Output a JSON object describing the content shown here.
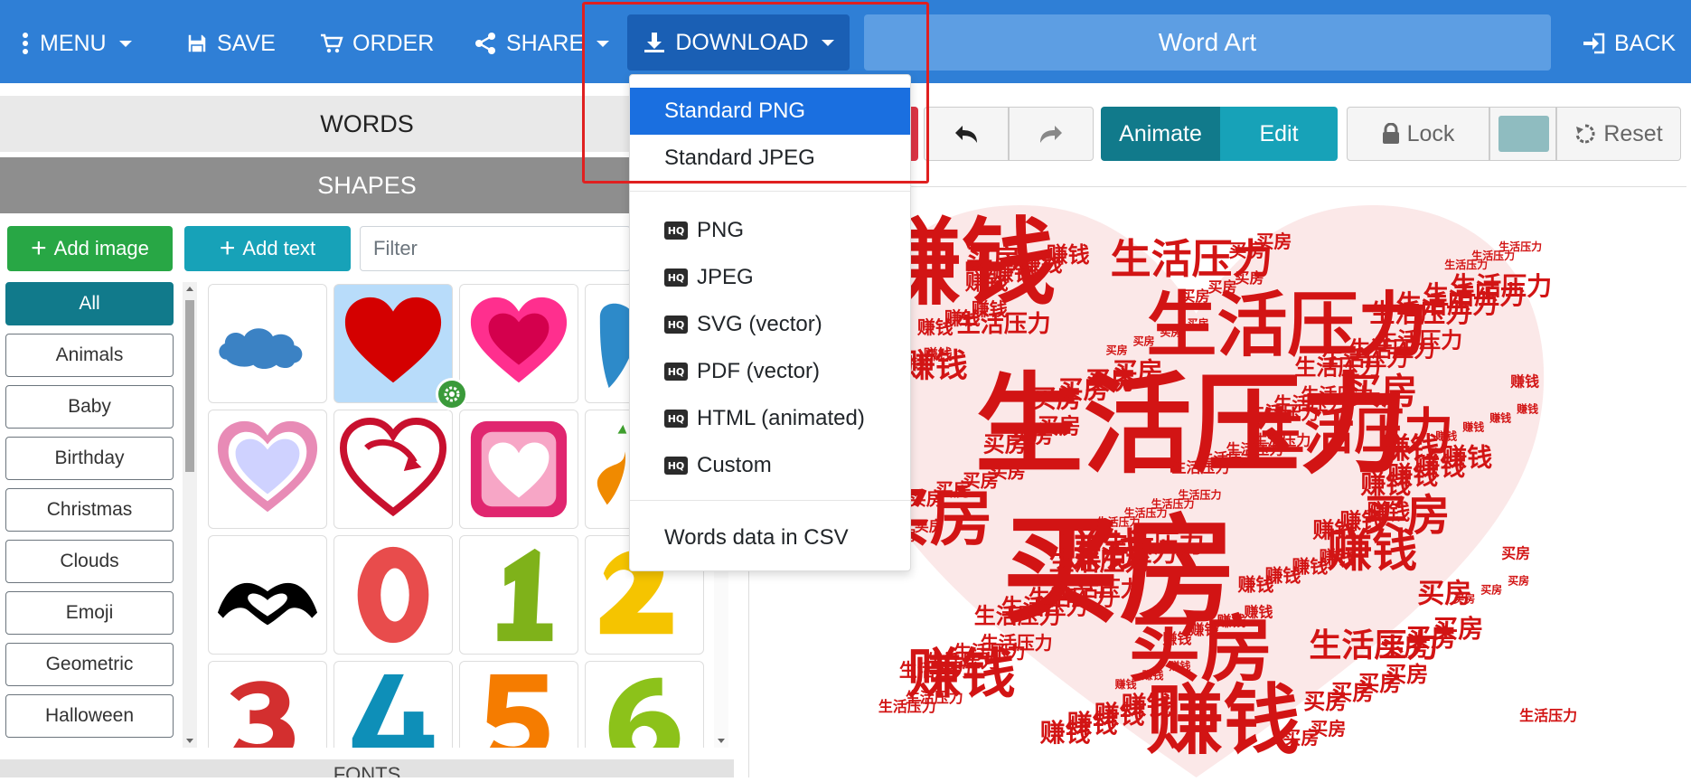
{
  "topbar": {
    "menu_label": "MENU",
    "save_label": "SAVE",
    "order_label": "ORDER",
    "share_label": "SHARE",
    "download_label": "DOWNLOAD",
    "title": "Word Art",
    "back_label": "BACK"
  },
  "left_panel": {
    "words_header": "WORDS",
    "shapes_header": "SHAPES",
    "fonts_header": "FONTS",
    "add_image_label": "Add image",
    "add_text_label": "Add text",
    "filter_placeholder": "Filter",
    "categories": [
      "All",
      "Animals",
      "Baby",
      "Birthday",
      "Christmas",
      "Clouds",
      "Emoji",
      "Geometric",
      "Halloween"
    ],
    "shape_tiles": [
      "cloud-shape",
      "red-heart-shape",
      "pink-heart-shape",
      "blue-drop-shape",
      "outline-heart-shape",
      "arrow-heart-shape",
      "square-heart-shape",
      "orange-leaf-shape",
      "hands-heart-shape",
      "zero-shape",
      "one-shape",
      "two-shape",
      "three-shape",
      "four-shape",
      "five-shape",
      "six-shape"
    ]
  },
  "toolbar": {
    "undo_icon": "undo-icon",
    "redo_icon": "redo-icon",
    "animate_label": "Animate",
    "edit_label": "Edit",
    "lock_label": "Lock",
    "reset_label": "Reset",
    "swatch_color": "#8fbcc0"
  },
  "download_menu": {
    "standard_png": "Standard PNG",
    "standard_jpeg": "Standard JPEG",
    "hq_badge": "HQ",
    "png": "PNG",
    "jpeg": "JPEG",
    "svg": "SVG (vector)",
    "pdf": "PDF (vector)",
    "html": "HTML (animated)",
    "custom": "Custom",
    "csv": "Words data in CSV"
  },
  "wordart": {
    "words": [
      "生活压力",
      "赚钱",
      "买房"
    ],
    "color": "#d21414"
  }
}
